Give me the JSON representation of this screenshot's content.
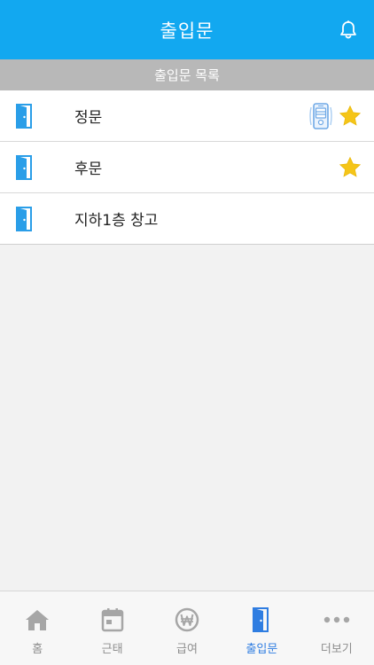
{
  "header": {
    "title": "출입문",
    "bg_color": "#12a8f0",
    "bell_icon": "bell-icon"
  },
  "section": {
    "title": "출입문 목록"
  },
  "doors": [
    {
      "label": "정문",
      "icon": "door-icon",
      "phone_unlock": true,
      "favorite": true
    },
    {
      "label": "후문",
      "icon": "door-icon",
      "phone_unlock": false,
      "favorite": true
    },
    {
      "label": "지하1층 창고",
      "icon": "door-icon",
      "phone_unlock": false,
      "favorite": false
    }
  ],
  "tabbar": {
    "active_color": "#2f7de1",
    "inactive_color": "#8e8e8e",
    "tabs": [
      {
        "label": "홈",
        "icon": "home-icon",
        "active": false
      },
      {
        "label": "근태",
        "icon": "calendar-icon",
        "active": false
      },
      {
        "label": "급여",
        "icon": "won-icon",
        "active": false
      },
      {
        "label": "출입문",
        "icon": "door-icon",
        "active": true
      },
      {
        "label": "더보기",
        "icon": "more-icon",
        "active": false
      }
    ]
  },
  "colors": {
    "door_blue": "#2a9ee8",
    "star_yellow": "#f5c518",
    "section_gray": "#b8b8b8"
  }
}
